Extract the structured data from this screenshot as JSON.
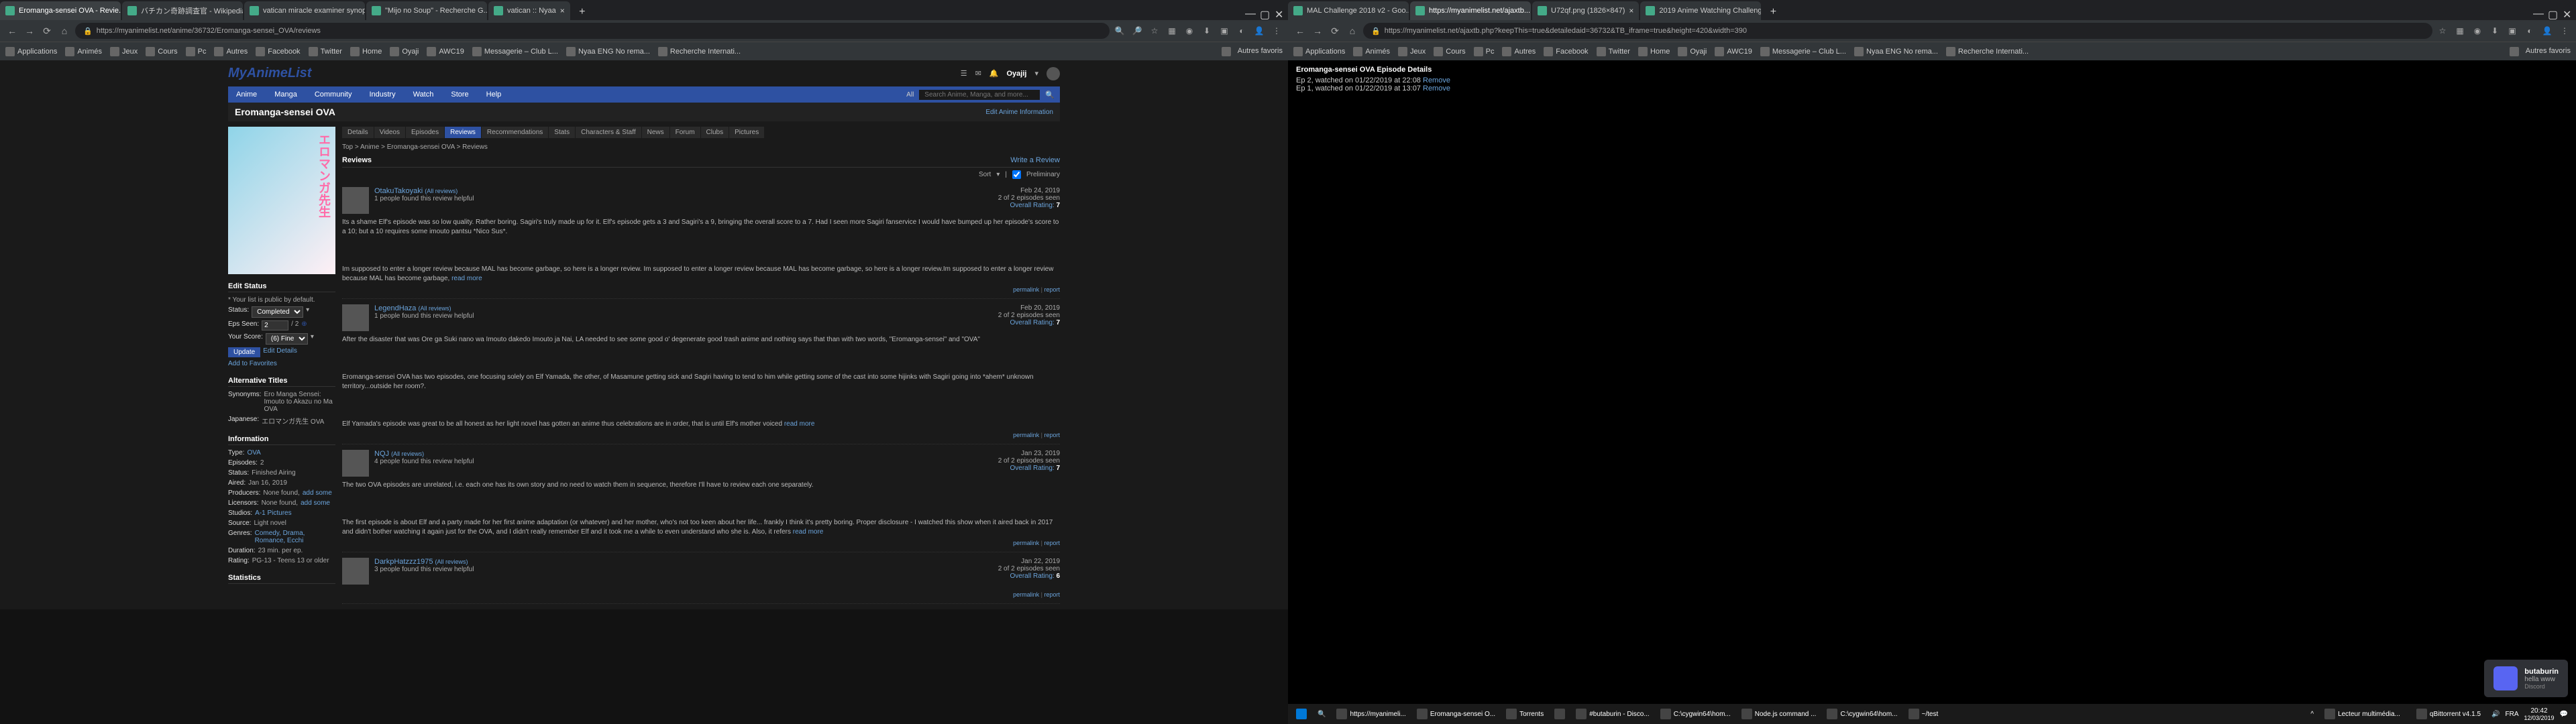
{
  "left_window": {
    "tabs": [
      {
        "title": "Eromanga-sensei OVA - Revie...",
        "active": true
      },
      {
        "title": "バチカン奇跡調査官 - Wikipedia",
        "active": false
      },
      {
        "title": "vatican miracle examiner synop...",
        "active": false
      },
      {
        "title": "\"Mijo no Soup\" - Recherche G...",
        "active": false
      },
      {
        "title": "vatican :: Nyaa",
        "active": false
      }
    ],
    "url": "https://myanimelist.net/anime/36732/Eromanga-sensei_OVA/reviews",
    "bookmarks": [
      "Applications",
      "Animés",
      "Jeux",
      "Cours",
      "Pc",
      "Autres",
      "Facebook",
      "Twitter",
      "Home",
      "Oyaji",
      "AWC19",
      "Messagerie – Club L...",
      "Nyaa ENG No rema...",
      "Recherche Internati..."
    ],
    "bookmarks_right": "Autres favoris",
    "mal": {
      "logo": "MyAnimeList",
      "nav": [
        "Anime",
        "Manga",
        "Community",
        "Industry",
        "Watch",
        "Store",
        "Help"
      ],
      "nav_all": "All",
      "search_placeholder": "Search Anime, Manga, and more...",
      "username": "Oyajij",
      "title": "Eromanga-sensei OVA",
      "edit_info": "Edit Anime Information",
      "tabs": [
        "Details",
        "Videos",
        "Episodes",
        "Reviews",
        "Recommendations",
        "Stats",
        "Characters & Staff",
        "News",
        "Forum",
        "Clubs",
        "Pictures"
      ],
      "active_tab": "Reviews",
      "breadcrumb": "Top  >  Anime  >  Eromanga-sensei OVA  >  Reviews",
      "reviews_label": "Reviews",
      "write_review": "Write a Review",
      "sort_label": "Sort",
      "preliminary_label": "Preliminary",
      "sidebar": {
        "edit_status": "Edit Status",
        "list_public": "* Your list is public by default.",
        "status_label": "Status:",
        "status_value": "Completed",
        "eps_label": "Eps Seen:",
        "eps_value": "2",
        "eps_total": "/ 2",
        "score_label": "Your Score:",
        "score_value": "(6) Fine",
        "update_btn": "Update",
        "edit_details": "Edit Details",
        "add_fav": "Add to Favorites",
        "alt_titles": "Alternative Titles",
        "synonyms_label": "Synonyms:",
        "synonyms": "Ero Manga Sensei: Imouto to Akazu no Ma OVA",
        "japanese_label": "Japanese:",
        "japanese": "エロマンガ先生 OVA",
        "information": "Information",
        "type_label": "Type:",
        "type": "OVA",
        "episodes_label": "Episodes:",
        "episodes": "2",
        "status2_label": "Status:",
        "status2": "Finished Airing",
        "aired_label": "Aired:",
        "aired": "Jan 16, 2019",
        "producers_label": "Producers:",
        "producers": "None found,",
        "add_some": "add some",
        "licensors_label": "Licensors:",
        "licensors": "None found,",
        "studios_label": "Studios:",
        "studios": "A-1 Pictures",
        "source_label": "Source:",
        "source": "Light novel",
        "genres_label": "Genres:",
        "genres": "Comedy, Drama, Romance, Ecchi",
        "duration_label": "Duration:",
        "duration": "23 min. per ep.",
        "rating_label": "Rating:",
        "rating": "PG-13 - Teens 13 or older",
        "statistics": "Statistics"
      },
      "reviews": [
        {
          "user": "OtakuTakoyaki",
          "all_reviews": "(All reviews)",
          "helpful": "1 people found this review helpful",
          "date": "Feb 24, 2019",
          "eps": "2 of 2 episodes seen",
          "rating_label": "Overall Rating:",
          "rating": "7",
          "body": "Its a shame Elf's episode was so low quality. Rather boring. Sagiri's truly made up for it. Elf's episode gets a 3 and Sagiri's a 9, bringing the overall score to a 7. Had I seen more Sagiri fanservice I would have bumped up her episode's score to a 10; but a 10 requires some imouto pantsu *Nico Sus*.\n\nIm supposed to enter a longer review because MAL has become garbage, so here is a longer review. Im supposed to enter a longer review because MAL has become garbage, so here is a longer review.Im supposed to enter a longer review because MAL has become garbage,",
          "read_more": "read more"
        },
        {
          "user": "LegendHaza",
          "all_reviews": "(All reviews)",
          "helpful": "1 people found this review helpful",
          "date": "Feb 20, 2019",
          "eps": "2 of 2 episodes seen",
          "rating_label": "Overall Rating:",
          "rating": "7",
          "body": "After the disaster that was Ore ga Suki nano wa Imouto dakedo Imouto ja Nai, LA needed to see some good o' degenerate good trash anime and nothing says that than with two words, \"Eromanga-sensei\" and \"OVA\"\n\nEromanga-sensei OVA has two episodes, one focusing solely on Elf Yamada, the other, of Masamune getting sick and Sagiri having to tend to him while getting some of the cast into some hijinks with Sagiri going into *ahem* unknown territory...outside her room?.\n\nElf Yamada's episode was great to be all honest as her light novel has gotten an anime thus celebrations are in order, that is until Elf's mother voiced",
          "read_more": "read more"
        },
        {
          "user": "NQJ",
          "all_reviews": "(All reviews)",
          "helpful": "4 people found this review helpful",
          "date": "Jan 23, 2019",
          "eps": "2 of 2 episodes seen",
          "rating_label": "Overall Rating:",
          "rating": "7",
          "body": "The two OVA episodes are unrelated, i.e. each one has its own story and no need to watch them in sequence, therefore I'll have to review each one separately.\n\nThe first episode is about Elf and a party made for her first anime adaptation (or whatever) and her mother, who's not too keen about her life... frankly I think it's pretty boring. Proper disclosure - I watched this show when it aired back in 2017 and didn't bother watching it again just for the OVA, and I didn't really remember Elf and it took me a while to even understand who she is. Also, it refers",
          "read_more": "read more"
        },
        {
          "user": "DarkpHatzzz1975",
          "all_reviews": "(All reviews)",
          "helpful": "3 people found this review helpful",
          "date": "Jan 22, 2019",
          "eps": "2 of 2 episodes seen",
          "rating_label": "Overall Rating:",
          "rating": "6",
          "body": ""
        }
      ],
      "permalink": "permalink",
      "report": "report"
    }
  },
  "right_window": {
    "tabs": [
      {
        "title": "MAL Challenge 2018 v2 - Goo...",
        "active": false
      },
      {
        "title": "https://myanimelist.net/ajaxtb...",
        "active": true
      },
      {
        "title": "U72qf.png (1826×847)",
        "active": false
      },
      {
        "title": "2019 Anime Watching Challeng...",
        "active": false
      }
    ],
    "url": "https://myanimelist.net/ajaxtb.php?keepThis=true&detailedaid=36732&TB_iframe=true&height=420&width=390",
    "bookmarks": [
      "Applications",
      "Animés",
      "Jeux",
      "Cours",
      "Pc",
      "Autres",
      "Facebook",
      "Twitter",
      "Home",
      "Oyaji",
      "AWC19",
      "Messagerie – Club L...",
      "Nyaa ENG No rema...",
      "Recherche Internati..."
    ],
    "bookmarks_right": "Autres favoris",
    "ep_details": {
      "title": "Eromanga-sensei OVA Episode Details",
      "lines": [
        "Ep 2, watched on 01/22/2019 at 22:08",
        "Ep 1, watched on 01/22/2019 at 13:07"
      ],
      "remove": "Remove"
    }
  },
  "discord": {
    "user": "butaburin",
    "msg": "hella www",
    "app": "Discord"
  },
  "taskbar": {
    "items": [
      "https://myanimeli...",
      "Eromanga-sensei O...",
      "Torrents",
      "#butaburin - Disco...",
      "C:\\cygwin64\\hom...",
      "Node.js command ...",
      "C:\\cygwin64\\hom...",
      "~/test"
    ],
    "tray": [
      "Lecteur multimédia...",
      "qBittorrent v4.1.5"
    ],
    "lang": "FRA",
    "time": "20:42",
    "date": "12/03/2019"
  }
}
